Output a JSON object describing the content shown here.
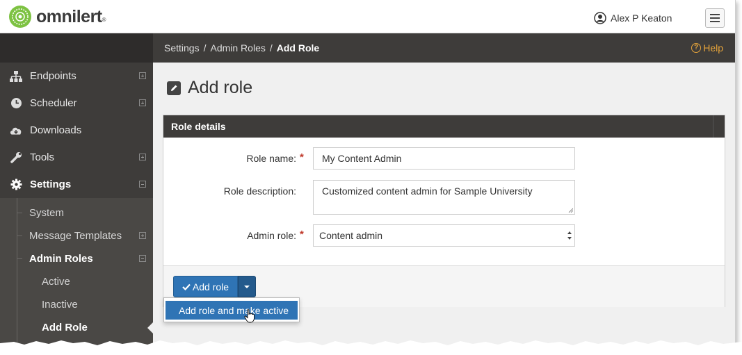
{
  "app": {
    "logo_text": "omnilert",
    "logo_mark": "®",
    "accent": "#2f74b5",
    "brand_green": "#7dc242"
  },
  "topbar": {
    "user_name": "Alex P Keaton",
    "user_icon": "user-circle-icon",
    "menu_icon": "hamburger-icon"
  },
  "sidebar": {
    "items": [
      {
        "label": "Endpoints",
        "icon": "sitemap-icon",
        "expander": "plus"
      },
      {
        "label": "Scheduler",
        "icon": "clock-icon",
        "expander": "plus"
      },
      {
        "label": "Downloads",
        "icon": "cloud-download-icon",
        "expander": ""
      },
      {
        "label": "Tools",
        "icon": "wrench-icon",
        "expander": "plus"
      },
      {
        "label": "Settings",
        "icon": "gear-icon",
        "expander": "minus"
      }
    ],
    "settings_sub": [
      {
        "label": "System"
      },
      {
        "label": "Message Templates"
      },
      {
        "label": "Admin Roles"
      }
    ],
    "admin_roles_sub": [
      {
        "label": "Active"
      },
      {
        "label": "Inactive"
      },
      {
        "label": "Add Role"
      }
    ]
  },
  "breadcrumb": {
    "items": [
      "Settings",
      "Admin Roles",
      "Add Role"
    ],
    "separator": "/",
    "help_label": "Help",
    "help_color": "#e7a53b"
  },
  "page": {
    "title": "Add role"
  },
  "panel": {
    "title": "Role details",
    "fields": {
      "role_name": {
        "label": "Role name:",
        "value": "My Content Admin",
        "required": "*"
      },
      "role_description": {
        "label": "Role description:",
        "value": "Customized content admin for Sample University"
      },
      "admin_role": {
        "label": "Admin role:",
        "value": "Content admin",
        "required": "*"
      }
    }
  },
  "actions": {
    "add_role_label": "Add role",
    "dropdown_item": "Add role and make active"
  }
}
